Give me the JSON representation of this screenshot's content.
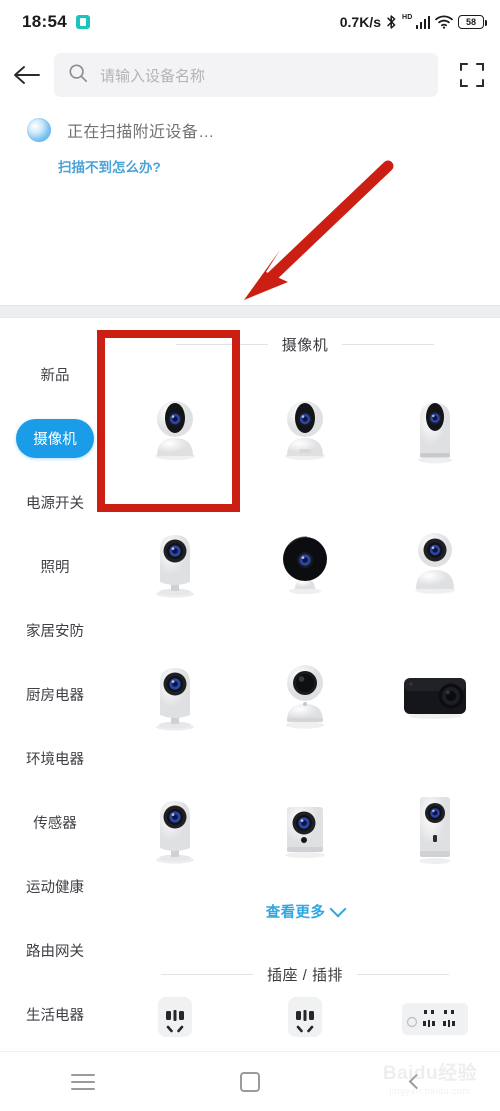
{
  "statusbar": {
    "time": "18:54",
    "app_indicator_icon": "app-square-icon",
    "network_speed": "0.7K/s",
    "bluetooth_icon": "bluetooth-icon",
    "hd_label": "HD",
    "signal_icon": "signal-bars-icon",
    "wifi_icon": "wifi-icon",
    "battery_level": "58"
  },
  "header": {
    "back_icon": "back-arrow-icon",
    "search_icon": "search-icon",
    "search_value": "",
    "search_placeholder": "请输入设备名称",
    "scan_icon": "scan-qr-icon"
  },
  "scanning": {
    "orb_icon": "scanning-orb-icon",
    "status_text": "正在扫描附近设备…",
    "help_link": "扫描不到怎么办?"
  },
  "sidebar": {
    "items": [
      {
        "label": "新品",
        "selected": false
      },
      {
        "label": "摄像机",
        "selected": true
      },
      {
        "label": "电源开关",
        "selected": false
      },
      {
        "label": "照明",
        "selected": false
      },
      {
        "label": "家居安防",
        "selected": false
      },
      {
        "label": "厨房电器",
        "selected": false
      },
      {
        "label": "环境电器",
        "selected": false
      },
      {
        "label": "传感器",
        "selected": false
      },
      {
        "label": "运动健康",
        "selected": false
      },
      {
        "label": "路由网关",
        "selected": false
      },
      {
        "label": "生活电器",
        "selected": false
      }
    ]
  },
  "content": {
    "section_camera_title": "摄像机",
    "camera_devices": [
      {
        "icon": "pan-tilt-camera-white-icon"
      },
      {
        "icon": "pan-tilt-camera-white-icon"
      },
      {
        "icon": "dome-camera-white-icon"
      },
      {
        "icon": "stand-camera-white-icon"
      },
      {
        "icon": "round-camera-black-icon"
      },
      {
        "icon": "pan-tilt-camera-round-icon"
      },
      {
        "icon": "stand-camera-white-icon"
      },
      {
        "icon": "pan-tilt-camera-dark-lens-icon"
      },
      {
        "icon": "action-camera-black-icon"
      },
      {
        "icon": "stand-camera-white-icon"
      },
      {
        "icon": "box-camera-white-icon"
      },
      {
        "icon": "tall-box-camera-white-icon"
      }
    ],
    "view_more_label": "查看更多",
    "view_more_chevron_icon": "chevron-down-icon",
    "section_socket_title": "插座 / 插排",
    "socket_devices": [
      {
        "icon": "smart-plug-icon"
      },
      {
        "icon": "smart-plug-icon"
      },
      {
        "icon": "power-strip-icon"
      }
    ]
  },
  "navbar": {
    "recents_icon": "hamburger-recents-icon",
    "home_icon": "home-square-icon",
    "back_icon": "back-chevron-icon"
  },
  "watermark": {
    "main": "Baidu经验",
    "sub": "jingyan.baidu.com"
  },
  "annotations": {
    "highlight_rect": "red-highlight-rectangle",
    "arrow": "red-pointer-arrow"
  },
  "colors": {
    "accent_blue": "#1a9ce8",
    "link_blue": "#2fa6e0",
    "annotation_red": "#cc1f14",
    "search_field_bg": "#f3f3f5",
    "band_gray": "#eceef0"
  }
}
